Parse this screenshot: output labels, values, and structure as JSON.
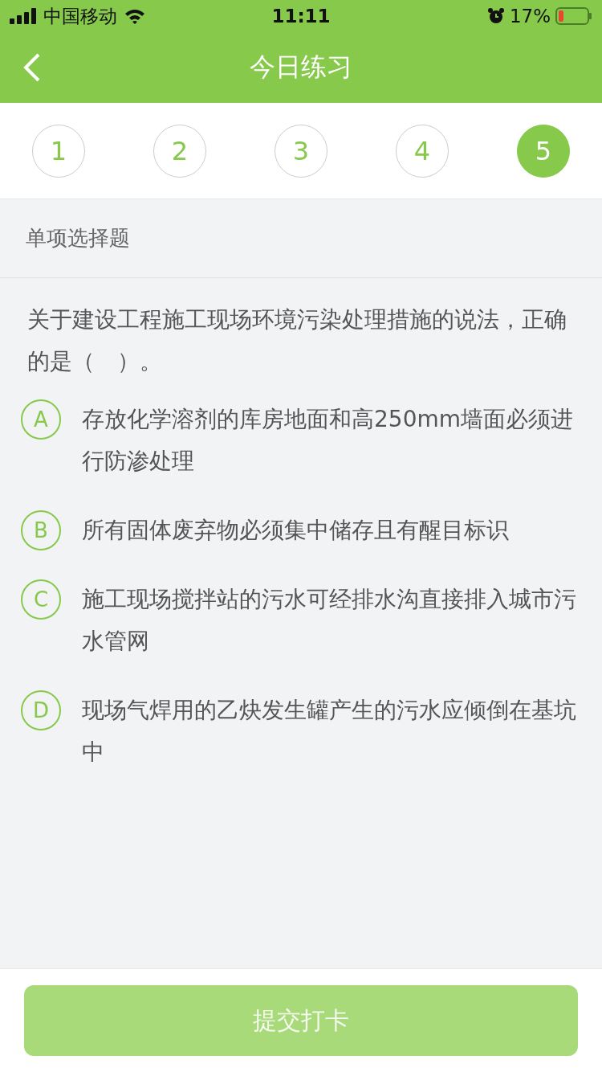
{
  "status_bar": {
    "carrier": "中国移动",
    "time": "11:11",
    "battery": "17%"
  },
  "nav": {
    "title": "今日练习"
  },
  "steps": [
    {
      "label": "1",
      "selected": false
    },
    {
      "label": "2",
      "selected": false
    },
    {
      "label": "3",
      "selected": false
    },
    {
      "label": "4",
      "selected": false
    },
    {
      "label": "5",
      "selected": true
    }
  ],
  "question": {
    "type": "单项选择题",
    "text": "关于建设工程施工现场环境污染处理措施的说法，正确的是（　）。",
    "options": [
      {
        "letter": "A",
        "text": "存放化学溶剂的库房地面和高250mm墙面必须进行防渗处理",
        "selected": false
      },
      {
        "letter": "B",
        "text": "所有固体废弃物必须集中储存且有醒目标识",
        "selected": false
      },
      {
        "letter": "C",
        "text": "施工现场搅拌站的污水可经排水沟直接排入城市污水管网",
        "selected": false
      },
      {
        "letter": "D",
        "text": "现场气焊用的乙炔发生罐产生的污水应倾倒在基坑中",
        "selected": false
      }
    ]
  },
  "submit": {
    "label": "提交打卡",
    "disabled": true
  }
}
